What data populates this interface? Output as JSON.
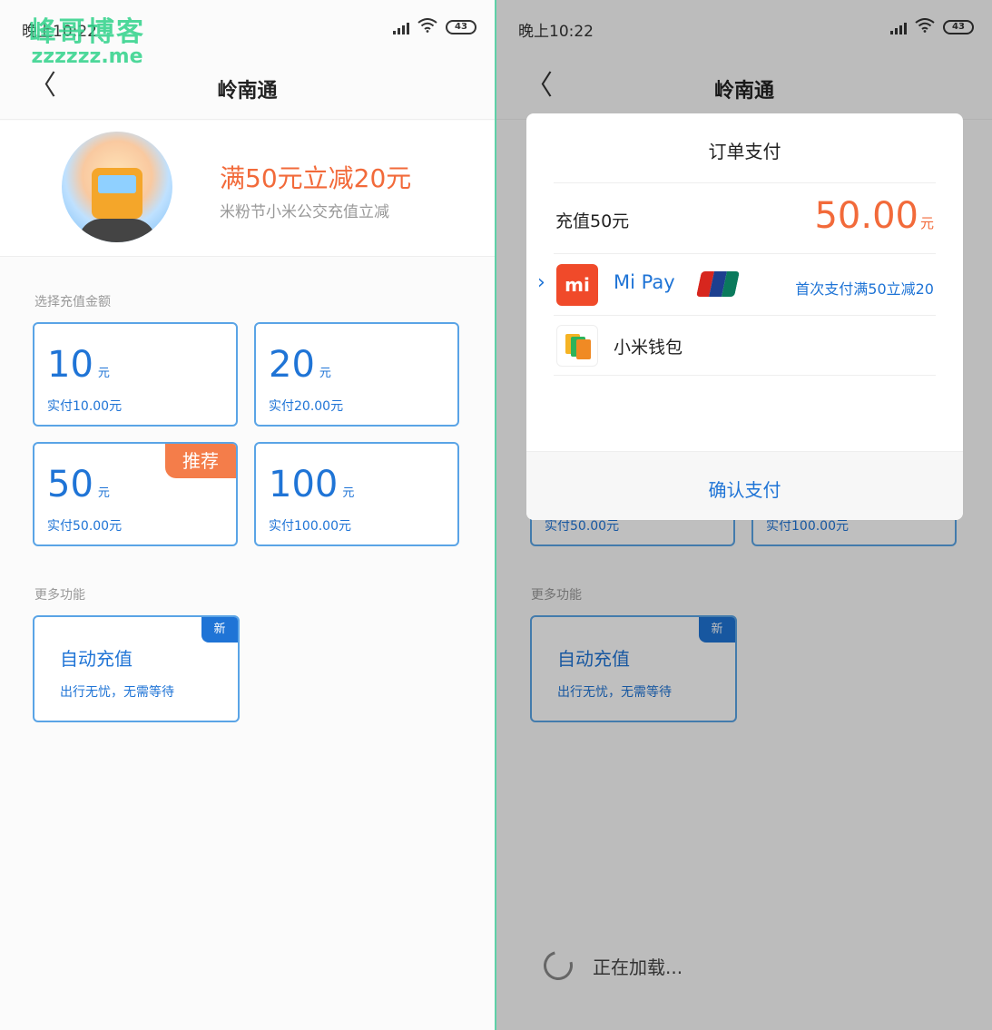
{
  "watermark": {
    "name": "峰哥博客",
    "url": "zzzzzz.me"
  },
  "status": {
    "time": "晚上10:22",
    "battery": "43"
  },
  "nav": {
    "back_symbol": "〈",
    "title": "岭南通"
  },
  "banner": {
    "title": "满50元立减20元",
    "subtitle": "米粉节小米公交充值立减"
  },
  "amount_section": {
    "label": "选择充值金额"
  },
  "amounts": [
    {
      "value": "10",
      "unit": "元",
      "pay": "实付10.00元"
    },
    {
      "value": "20",
      "unit": "元",
      "pay": "实付20.00元"
    },
    {
      "value": "50",
      "unit": "元",
      "pay": "实付50.00元",
      "badge": "推荐"
    },
    {
      "value": "100",
      "unit": "元",
      "pay": "实付100.00元"
    }
  ],
  "more_section": {
    "label": "更多功能"
  },
  "auto_recharge": {
    "title": "自动充值",
    "subtitle": "出行无忧，无需等待",
    "badge": "新"
  },
  "dialog": {
    "title": "订单支付",
    "item_label": "充值50元",
    "amount": "50.00",
    "amount_unit": "元",
    "methods": [
      {
        "name": "Mi Pay",
        "icon": "mi-logo-icon",
        "promo": "首次支付满50立减20",
        "selected": true
      },
      {
        "name": "小米钱包",
        "icon": "wallet-icon",
        "promo": "",
        "selected": false
      }
    ],
    "confirm": "确认支付"
  },
  "loading": {
    "text": "正在加载..."
  },
  "colors": {
    "accent": "#1f74d6",
    "orange": "#f26a3a",
    "card_border": "#5aa4e6",
    "divider": "#5fd1a8"
  }
}
